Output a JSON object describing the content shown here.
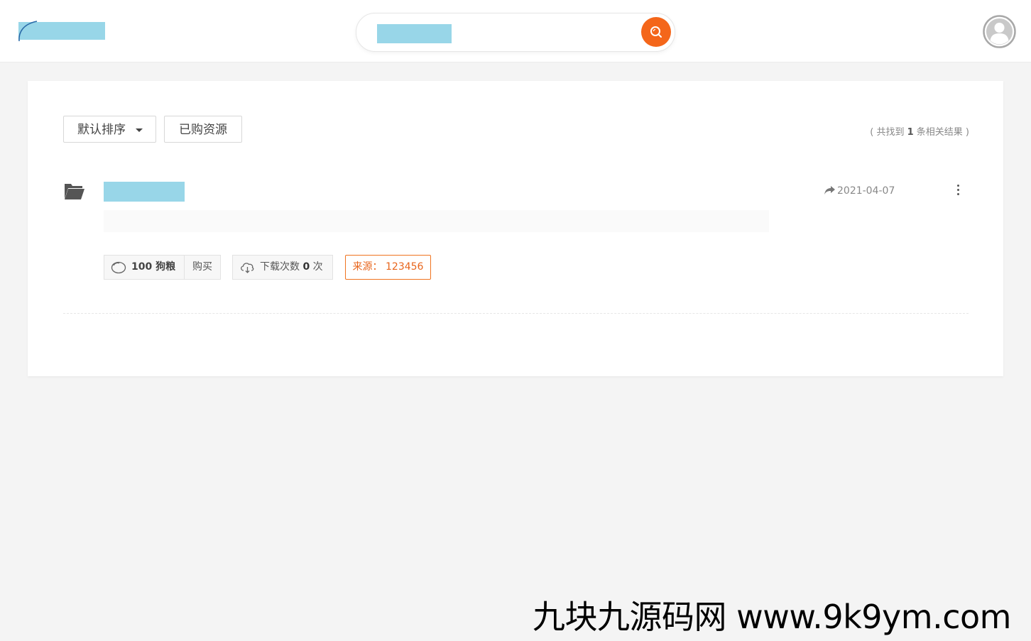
{
  "header": {
    "search": {
      "button_icon": "search-icon"
    },
    "avatar_icon": "user-avatar-icon"
  },
  "toolbar": {
    "sort_label": "默认排序",
    "purchased_label": "已购资源",
    "result_prefix": "( 共找到 ",
    "result_count": "1",
    "result_suffix": " 条相关结果 )"
  },
  "result": {
    "date": "2021-04-07",
    "price_label": "100 狗粮",
    "buy_label": "购买",
    "downloads_prefix": "下载次数 ",
    "downloads_count": "0",
    "downloads_suffix": " 次",
    "source_label": "来源：",
    "source_value": "123456"
  },
  "watermark": "九块九源码网 www.9k9ym.com",
  "colors": {
    "accent": "#f4661a",
    "redacted": "#98d6e8",
    "background": "#f4f4f4"
  }
}
